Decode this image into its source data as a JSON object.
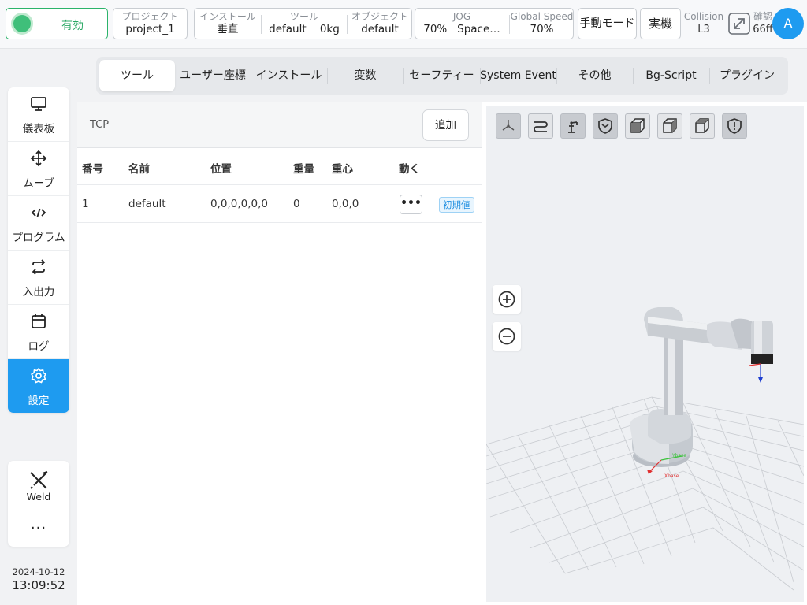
{
  "topbar": {
    "enable_label": "有効",
    "project": {
      "label": "プロジェクト",
      "value": "project_1"
    },
    "install": {
      "label": "インストール",
      "value": "垂直"
    },
    "tool": {
      "label": "ツール",
      "value": "default",
      "weight": "0kg"
    },
    "object": {
      "label": "オブジェクト",
      "value": "default"
    },
    "jog": {
      "label": "JOG",
      "speed": "70%",
      "frame": "Space…"
    },
    "global_speed": {
      "label": "Global Speed",
      "value": "70%"
    },
    "manual_mode": "手動モード",
    "real_robot": "実機",
    "collision": {
      "label": "Collision",
      "value": "L3"
    },
    "confirm": {
      "label": "確認",
      "value": "66ff"
    },
    "avatar": "A"
  },
  "nav": {
    "items": [
      {
        "label": "儀表板",
        "icon": "monitor-icon"
      },
      {
        "label": "ムーブ",
        "icon": "move-icon"
      },
      {
        "label": "プログラム",
        "icon": "code-icon"
      },
      {
        "label": "入出力",
        "icon": "swap-icon"
      },
      {
        "label": "ログ",
        "icon": "calendar-icon"
      },
      {
        "label": "設定",
        "icon": "gear-icon",
        "active": true
      }
    ],
    "weld_label": "Weld",
    "more_label": "···"
  },
  "datetime": {
    "date": "2024-10-12",
    "time": "13:09:52"
  },
  "tabs": [
    "ツール",
    "ユーザー座標",
    "インストール",
    "変数",
    "セーフティー",
    "System Event",
    "その他",
    "Bg-Script",
    "プラグイン"
  ],
  "tcp": {
    "title": "TCP",
    "add_label": "追加",
    "columns": [
      "番号",
      "名前",
      "位置",
      "重量",
      "重心",
      "動く"
    ],
    "rows": [
      {
        "no": "1",
        "name": "default",
        "position": "0,0,0,0,0,0",
        "weight": "0",
        "cog": "0,0,0",
        "badge": "初期値"
      }
    ]
  },
  "viewer": {
    "toolbar_icons": [
      "axes-icon",
      "path-icon",
      "robot-icon",
      "shield-icon",
      "cube-front-icon",
      "cube-side-icon",
      "cube-top-icon",
      "shield-warning-icon"
    ],
    "axis_x_label": "Xbase",
    "axis_y_label": "Ybase"
  },
  "colors": {
    "accent": "#1e9bf0",
    "enable_green": "#2bb36a",
    "badge_blue": "#1e8ee0"
  }
}
